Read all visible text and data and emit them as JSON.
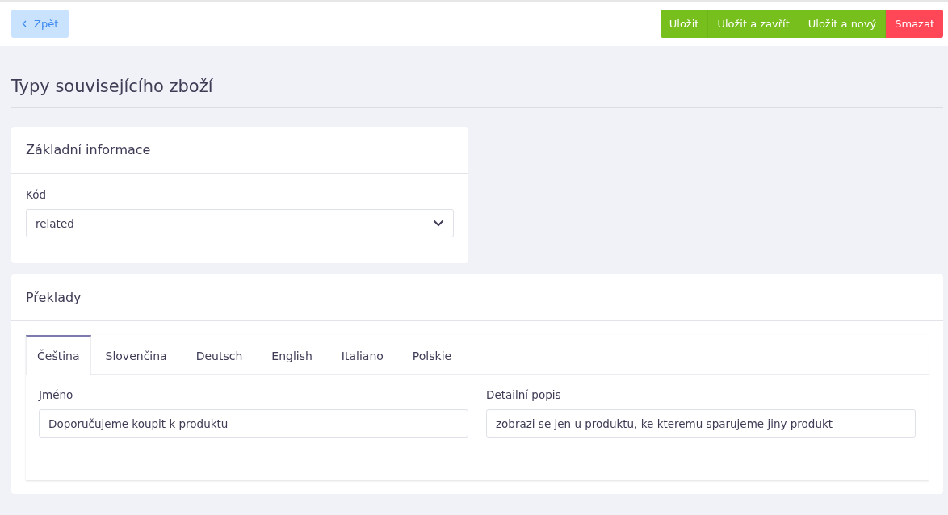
{
  "toolbar": {
    "back": {
      "label": "Zpět"
    },
    "actions": [
      {
        "label": "Uložit",
        "kind": "primary"
      },
      {
        "label": "Uložit a zavřít",
        "kind": "primary"
      },
      {
        "label": "Uložit a nový",
        "kind": "primary"
      },
      {
        "label": "Smazat",
        "kind": "danger"
      }
    ]
  },
  "page_title": "Typy souvisejícího zboží",
  "basic_card": {
    "title": "Základní informace",
    "field": {
      "label": "Kód",
      "value": "related"
    }
  },
  "translations_card": {
    "title": "Překlady",
    "tabs": [
      {
        "label": "Čeština",
        "selected": true
      },
      {
        "label": "Slovenčina",
        "selected": false
      },
      {
        "label": "Deutsch",
        "selected": false
      },
      {
        "label": "English",
        "selected": false
      },
      {
        "label": "Italiano",
        "selected": false
      },
      {
        "label": "Polskie",
        "selected": false
      }
    ],
    "fields": [
      {
        "label": "Jméno",
        "value": "Doporučujeme koupit k produktu"
      },
      {
        "label": "Detailní popis",
        "value": "zobrazi se jen u produktu, ke kteremu sparujeme jiny produkt"
      }
    ]
  }
}
